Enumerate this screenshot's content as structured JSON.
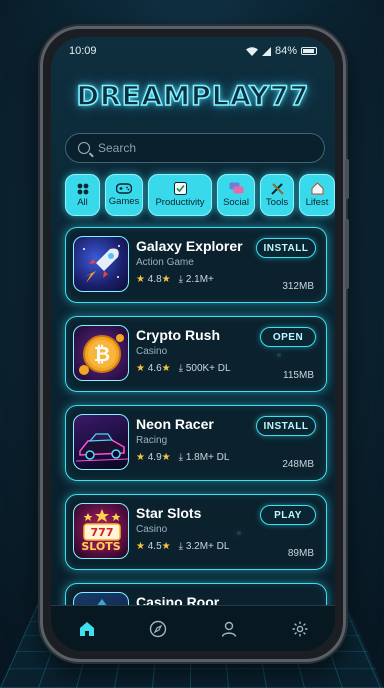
{
  "status": {
    "time": "10:09",
    "battery": "84%"
  },
  "brand": "DREAMPLAY77",
  "search": {
    "placeholder": "Search"
  },
  "categories": [
    {
      "label": "All",
      "icon": "grid-icon"
    },
    {
      "label": "Games",
      "icon": "gamepad-icon"
    },
    {
      "label": "Productivity",
      "icon": "checklist-icon"
    },
    {
      "label": "Social",
      "icon": "chat-icon"
    },
    {
      "label": "Tools",
      "icon": "tools-icon"
    },
    {
      "label": "Lifest",
      "icon": "house-icon"
    }
  ],
  "apps": [
    {
      "name": "Galaxy Explorer",
      "category": "Action Game",
      "rating": "4.8",
      "downloads": "2.1M+",
      "action": "INSTALL",
      "size": "312MB",
      "icon": "rocket-icon"
    },
    {
      "name": "Crypto Rush",
      "category": "Casino",
      "rating": "4.6",
      "downloads": "500K+ DL",
      "action": "OPEN",
      "size": "115MB",
      "icon": "bitcoin-icon"
    },
    {
      "name": "Neon Racer",
      "category": "Racing",
      "rating": "4.9",
      "downloads": "1.8M+ DL",
      "action": "INSTALL",
      "size": "248MB",
      "icon": "car-icon"
    },
    {
      "name": "Star Slots",
      "category": "Casino",
      "rating": "4.5",
      "downloads": "3.2M+ DL",
      "action": "PLAY",
      "size": "89MB",
      "icon": "slots-icon"
    },
    {
      "name": "Casino Roor",
      "category": "",
      "rating": "",
      "downloads": "",
      "action": "",
      "size": "",
      "icon": "casino-icon"
    }
  ],
  "slots_icon_text": "SLOTS",
  "tabbar": [
    "home-icon",
    "compass-icon",
    "profile-icon",
    "settings-icon"
  ],
  "colors": {
    "accent": "#3de0f0",
    "star": "#f5c542",
    "background": "#0a2533"
  }
}
